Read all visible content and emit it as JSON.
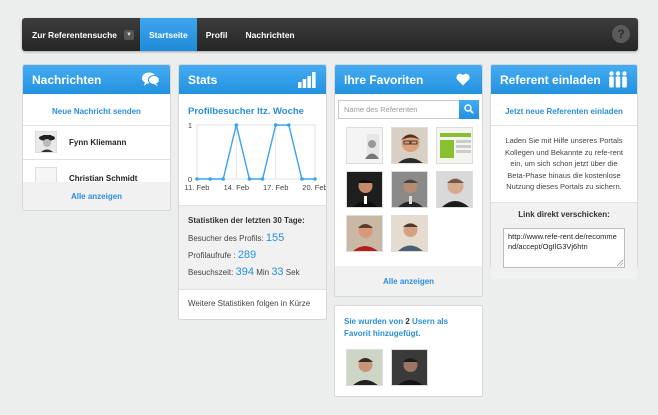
{
  "navbar": {
    "dropdown_label": "Zur Referentensuche",
    "items": [
      {
        "label": "Startseite",
        "active": true
      },
      {
        "label": "Profil",
        "active": false
      },
      {
        "label": "Nachrichten",
        "active": false
      }
    ],
    "help_label": "?"
  },
  "messages": {
    "title": "Nachrichten",
    "icon": "chat-bubbles-icon",
    "new_link": "Neue Nachricht senden",
    "items": [
      {
        "name": "Fynn Kliemann",
        "avatar": "portrait-bw"
      },
      {
        "name": "Christian Schmidt",
        "avatar": "empty"
      }
    ],
    "show_all": "Alle anzeigen"
  },
  "stats": {
    "title": "Stats",
    "icon": "bar-chart-icon",
    "chart_title": "Profilbesucher ltz. Woche",
    "period_header": "Statistiken der letzten 30 Tage:",
    "visitors_label": "Besucher des Profils:",
    "visitors_value": "155",
    "calls_label": "Profilaufrufe :",
    "calls_value": "289",
    "time_label": "Besuchszeit:",
    "time_min": "394",
    "time_min_unit": "Min",
    "time_sec": "33",
    "time_sec_unit": "Sek",
    "footer": "Weitere Statistiken folgen in Kürze"
  },
  "chart_data": {
    "type": "line",
    "title": "Profilbesucher ltz. Woche",
    "x": [
      "11. Feb",
      "12. Feb",
      "13. Feb",
      "14. Feb",
      "15. Feb",
      "16. Feb",
      "17. Feb",
      "18. Feb",
      "19. Feb",
      "20. Feb"
    ],
    "xticks": [
      "11. Feb",
      "14. Feb",
      "17. Feb",
      "20. Feb"
    ],
    "y": [
      0,
      0,
      0,
      1,
      0,
      0,
      1,
      1,
      0,
      0
    ],
    "yticks": [
      "0",
      "1"
    ],
    "ylim": [
      0,
      1
    ],
    "grid": true,
    "color": "#3aa3ef"
  },
  "favorites": {
    "title": "Ihre Favoriten",
    "icon": "heart-icon",
    "search_placeholder": "Name des Referenten",
    "show_all": "Alle anzeigen",
    "added_prefix": "Sie wurden von",
    "added_count": "2",
    "added_middle": "Usern",
    "added_suffix": "als Favorit hinzugefügt."
  },
  "referral": {
    "title": "Referent einladen",
    "icon": "people-icon",
    "invite_link": "Jetzt neue Referenten einladen",
    "description": "Laden Sie mit Hilfe unseres Portals Kollegen und Bekannte zu refe-rent ein, um sich schon jetzt über die Beta-Phase hinaus die kostenlose Nutzung dieses Portals zu sichern.",
    "link_label": "Link direkt verschicken:",
    "link_value": "http://www.refe-rent.de/recommend/accept/OgIlG3Vj6htn"
  }
}
